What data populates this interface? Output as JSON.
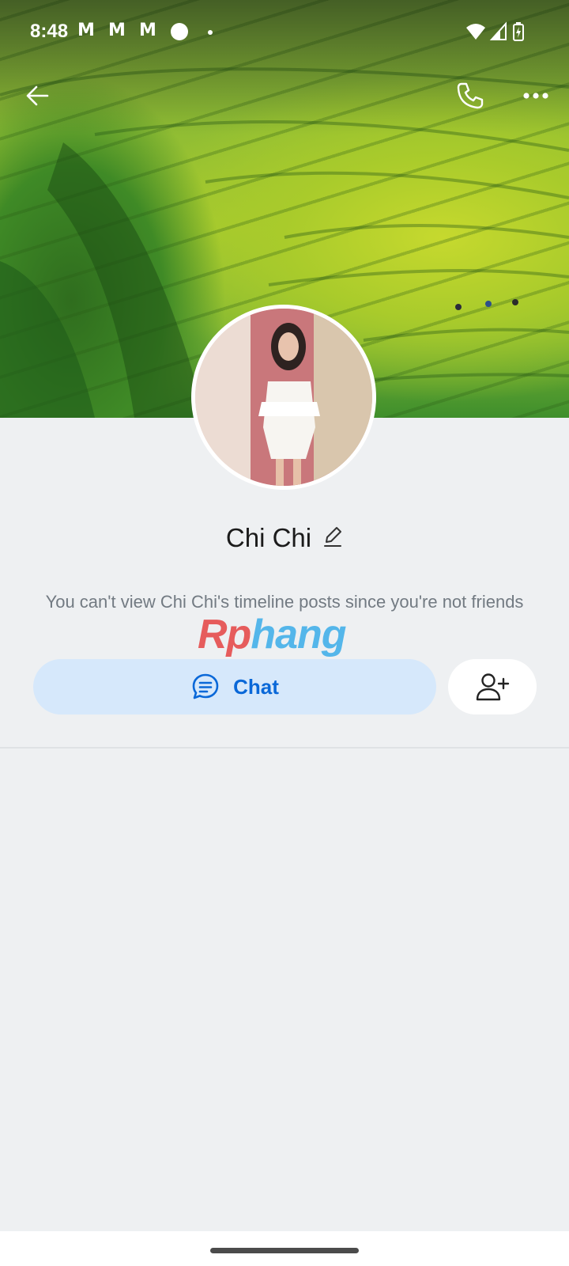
{
  "status_bar": {
    "time": "8:48",
    "notification_icons": [
      "gmail-icon",
      "gmail-icon",
      "gmail-icon",
      "record-dot-icon",
      "more-dot-icon"
    ],
    "system_icons": [
      "wifi-icon",
      "signal-icon",
      "battery-charging-icon"
    ],
    "mail_glyph": "M"
  },
  "header": {
    "back_icon": "arrow-left-icon",
    "call_icon": "phone-icon",
    "more_icon": "more-horizontal-icon"
  },
  "profile": {
    "name": "Chi Chi",
    "edit_icon": "pencil-icon",
    "notice": "You can't view Chi Chi's timeline posts since you're not friends"
  },
  "watermark": {
    "text_a": "Rp",
    "text_b": "hang"
  },
  "actions": {
    "chat_label": "Chat",
    "chat_icon": "chat-bubble-icon",
    "add_friend_icon": "add-user-icon"
  },
  "colors": {
    "accent": "#0a68d8",
    "chat_button_bg": "#d6e8fb",
    "page_bg": "#eef0f2"
  }
}
